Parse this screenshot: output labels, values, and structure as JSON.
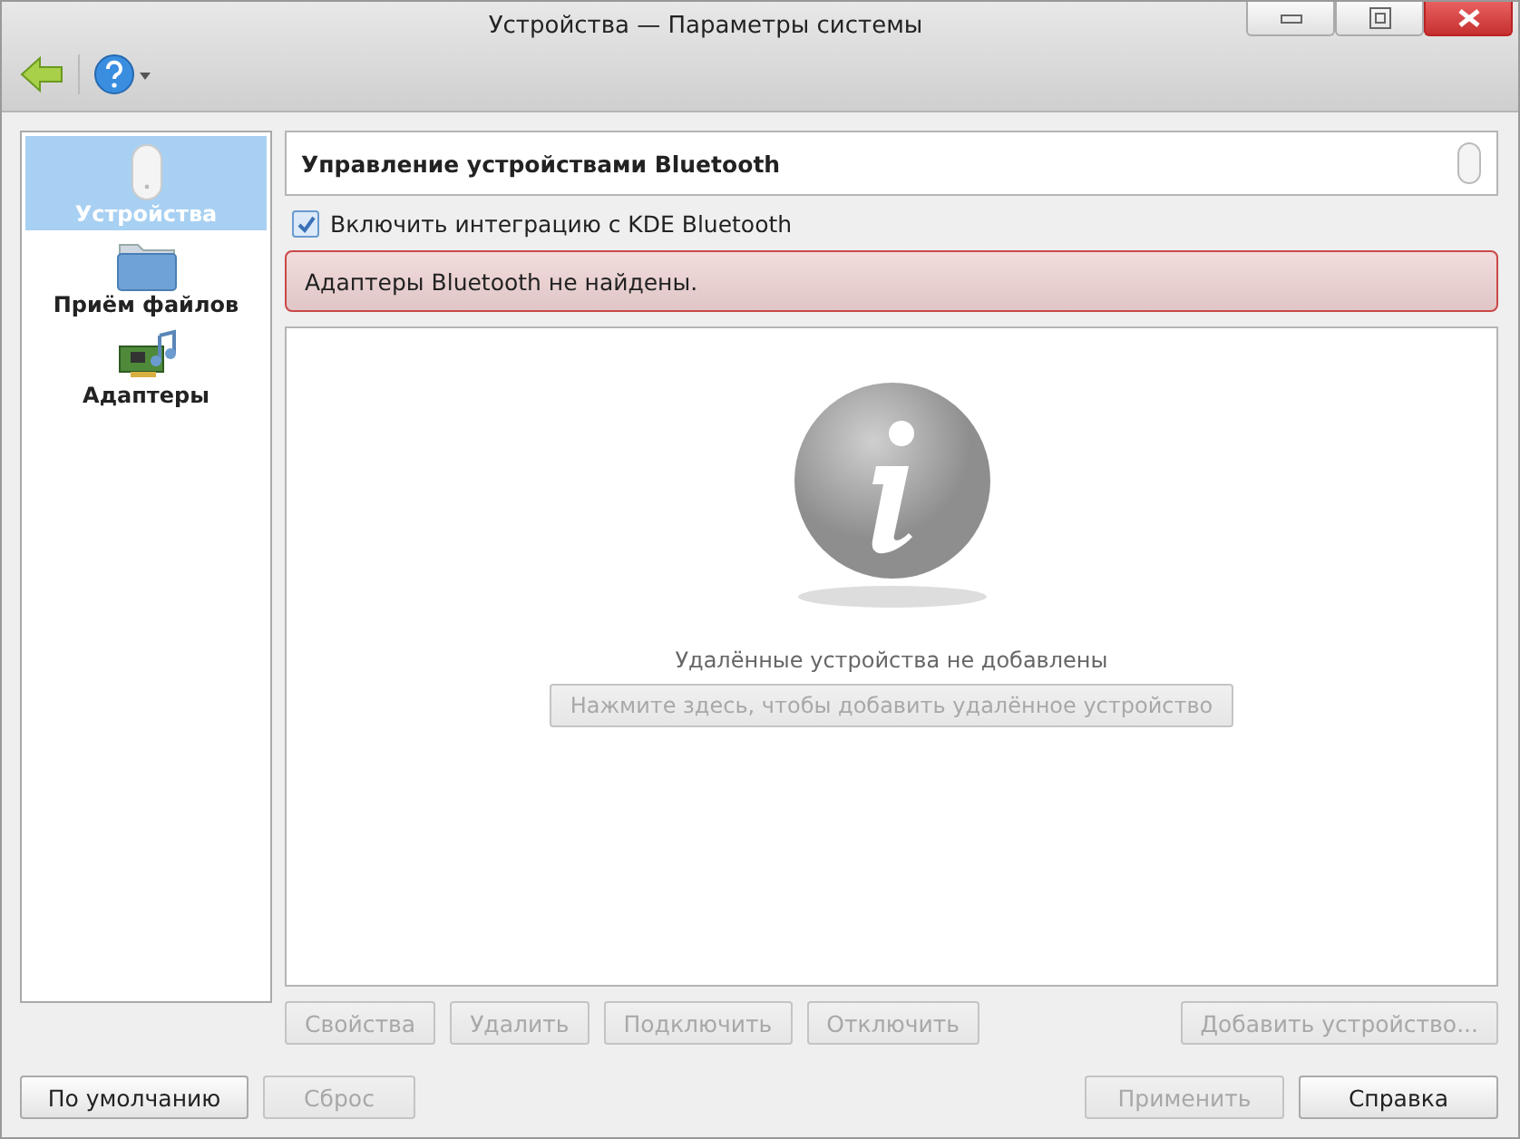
{
  "window": {
    "title": "Устройства — Параметры системы"
  },
  "sidebar": {
    "items": [
      {
        "label": "Устройства",
        "kind": "mouse",
        "selected": true
      },
      {
        "label": "Приём файлов",
        "kind": "folder",
        "selected": false
      },
      {
        "label": "Адаптеры",
        "kind": "card",
        "selected": false
      }
    ]
  },
  "header": {
    "title": "Управление устройствами Bluetooth"
  },
  "integration": {
    "label": "Включить интеграцию с KDE Bluetooth",
    "checked": true
  },
  "error": {
    "message": "Адаптеры Bluetooth не найдены."
  },
  "devices": {
    "empty_text": "Удалённые устройства не добавлены",
    "add_link": {
      "label": "Нажмите здесь, чтобы добавить удалённое устройство",
      "disabled": true
    }
  },
  "device_buttons": [
    {
      "label": "Свойства",
      "disabled": true
    },
    {
      "label": "Удалить",
      "disabled": true
    },
    {
      "label": "Подключить",
      "disabled": true
    },
    {
      "label": "Отключить",
      "disabled": true
    },
    {
      "label": "Добавить устройство...",
      "disabled": true
    }
  ],
  "dialog_buttons": [
    {
      "label": "По умолчанию",
      "disabled": false
    },
    {
      "label": "Сброс",
      "disabled": true
    },
    {
      "label": "Применить",
      "disabled": true
    },
    {
      "label": "Справка",
      "disabled": false
    }
  ]
}
